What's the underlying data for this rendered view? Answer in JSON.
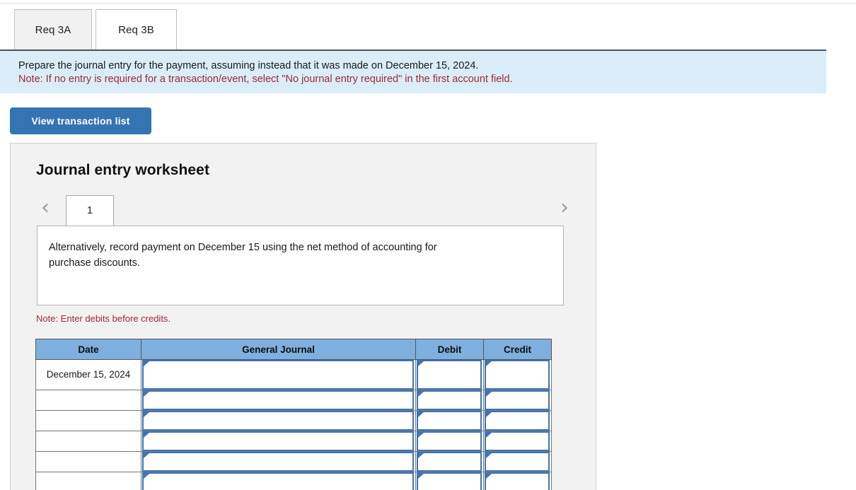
{
  "tabs": [
    {
      "label": "Req 3A",
      "active": false
    },
    {
      "label": "Req 3B",
      "active": true
    }
  ],
  "instructions": {
    "line1": "Prepare the journal entry for the payment, assuming instead that it was made on December 15, 2024.",
    "line2": "Note: If no entry is required for a transaction/event, select \"No journal entry required\" in the first account field."
  },
  "toolbar": {
    "view_transaction_list": "View transaction list"
  },
  "worksheet": {
    "title": "Journal entry worksheet",
    "prev_icon": "chevron-left-icon",
    "next_icon": "chevron-right-icon",
    "page_tab": "1",
    "scenario": "Alternatively, record payment on December 15 using the net method of accounting for purchase discounts.",
    "note_debits": "Note: Enter debits before credits."
  },
  "table": {
    "headers": [
      "Date",
      "General Journal",
      "Debit",
      "Credit"
    ],
    "rows": [
      {
        "date": "December 15, 2024",
        "general_journal": "",
        "debit": "",
        "credit": "",
        "tall": true
      },
      {
        "date": "",
        "general_journal": "",
        "debit": "",
        "credit": "",
        "tall": false
      },
      {
        "date": "",
        "general_journal": "",
        "debit": "",
        "credit": "",
        "tall": false
      },
      {
        "date": "",
        "general_journal": "",
        "debit": "",
        "credit": "",
        "tall": false
      },
      {
        "date": "",
        "general_journal": "",
        "debit": "",
        "credit": "",
        "tall": false
      },
      {
        "date": "",
        "general_journal": "",
        "debit": "",
        "credit": "",
        "tall": false
      }
    ]
  },
  "colors": {
    "accent_blue": "#3574b3",
    "header_blue": "#7eafde",
    "banner_blue": "#daedf9",
    "note_red": "#9e2a33",
    "input_border": "#3f75b4"
  }
}
